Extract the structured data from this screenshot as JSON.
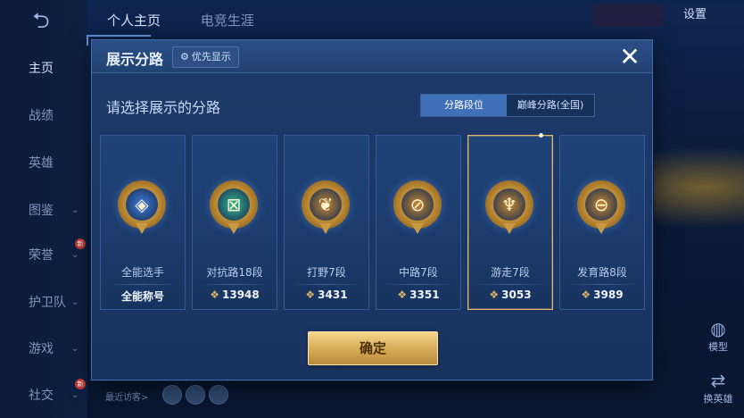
{
  "nav": {
    "back_icon": "back-arrow-icon",
    "items": [
      {
        "label": "主页",
        "active": true,
        "chevron": false,
        "badge": ""
      },
      {
        "label": "战绩",
        "active": false,
        "chevron": false,
        "badge": ""
      },
      {
        "label": "英雄",
        "active": false,
        "chevron": false,
        "badge": ""
      },
      {
        "label": "图鉴",
        "active": false,
        "chevron": true,
        "badge": ""
      },
      {
        "label": "荣誉",
        "active": false,
        "chevron": true,
        "badge": "新"
      },
      {
        "label": "护卫队",
        "active": false,
        "chevron": true,
        "badge": ""
      },
      {
        "label": "游戏",
        "active": false,
        "chevron": true,
        "badge": ""
      },
      {
        "label": "社交",
        "active": false,
        "chevron": true,
        "badge": "新"
      }
    ]
  },
  "top_tabs": [
    "个人主页",
    "电竞生涯"
  ],
  "settings_label": "设置",
  "recent_visitors_label": "最近访客>",
  "right_buttons": {
    "model_label": "模型",
    "swap_label": "换英雄"
  },
  "modal": {
    "title": "展示分路",
    "priority_label": "优先显示",
    "close_symbol": "✕",
    "subtitle": "请选择展示的分路",
    "toggle": {
      "option_1": "分路段位",
      "option_2": "巅峰分路(全国)",
      "selected": "分路段位"
    },
    "cards": [
      {
        "name": "全能选手",
        "score": "全能称号",
        "icon": "all-round-medal-icon",
        "glyph": "◈",
        "selected": false,
        "show_gem": false,
        "medal_color": "#3d7fe0"
      },
      {
        "name": "对抗路18段",
        "score": "13948",
        "icon": "clash-lane-medal-icon",
        "glyph": "⊠",
        "selected": false,
        "show_gem": true,
        "medal_color": "#2fbf8f"
      },
      {
        "name": "打野7段",
        "score": "3431",
        "icon": "jungle-medal-icon",
        "glyph": "❦",
        "selected": false,
        "show_gem": true,
        "medal_color": "#c98a2c"
      },
      {
        "name": "中路7段",
        "score": "3351",
        "icon": "mid-lane-medal-icon",
        "glyph": "⊘",
        "selected": false,
        "show_gem": true,
        "medal_color": "#c98a2c"
      },
      {
        "name": "游走7段",
        "score": "3053",
        "icon": "roam-medal-icon",
        "glyph": "♆",
        "selected": true,
        "show_gem": true,
        "medal_color": "#c98a2c"
      },
      {
        "name": "发育路8段",
        "score": "3989",
        "icon": "farm-lane-medal-icon",
        "glyph": "⊖",
        "selected": false,
        "show_gem": true,
        "medal_color": "#c98a2c"
      }
    ],
    "confirm_label": "确定"
  },
  "colors": {
    "accent_gold": "#e5b66a",
    "panel_blue": "#1d3a6a",
    "toggle_selected": "#3f70b8"
  }
}
